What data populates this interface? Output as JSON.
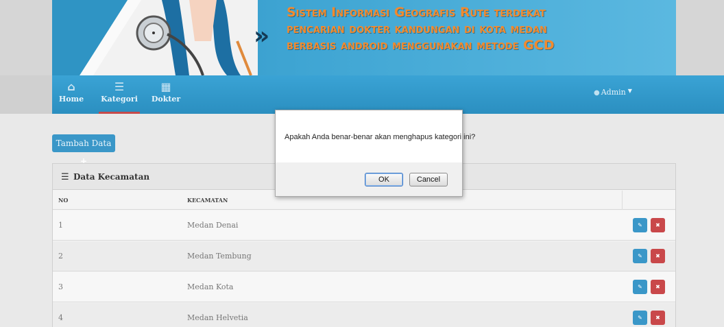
{
  "banner": {
    "title_lines": [
      "Sistem Informasi Geografis  Rute terdekat",
      "pencarian dokter kandungan di kota medan",
      "berbasis android menggunakan metode GCD"
    ],
    "arrows": "»"
  },
  "navbar": {
    "items": [
      {
        "label": "Home",
        "icon": "home-icon",
        "glyph": "⌂"
      },
      {
        "label": "Kategori",
        "icon": "list-icon",
        "glyph": "☰"
      },
      {
        "label": "Dokter",
        "icon": "calendar-icon",
        "glyph": "▦"
      }
    ],
    "user": {
      "label": "Admin",
      "caret": "▼"
    }
  },
  "toolbar": {
    "add_label": "Tambah Data",
    "add_icon": "+"
  },
  "panel": {
    "title": "Data Kecamatan",
    "columns": [
      "NO",
      "KECAMATAN"
    ],
    "rows": [
      {
        "no": "1",
        "kecamatan": "Medan Denai"
      },
      {
        "no": "2",
        "kecamatan": "Medan Tembung"
      },
      {
        "no": "3",
        "kecamatan": "Medan Kota"
      },
      {
        "no": "4",
        "kecamatan": "Medan Helvetia"
      }
    ],
    "edit_glyph": "✎",
    "delete_glyph": "✖"
  },
  "dialog": {
    "message": "Apakah Anda benar-benar akan menghapus kategori ini?",
    "ok_label": "OK",
    "cancel_label": "Cancel"
  },
  "colors": {
    "brand_blue": "#3aa3d5",
    "title_orange": "#f28a2e",
    "delete_red": "#c9484a",
    "edit_blue": "#3a97c8"
  }
}
